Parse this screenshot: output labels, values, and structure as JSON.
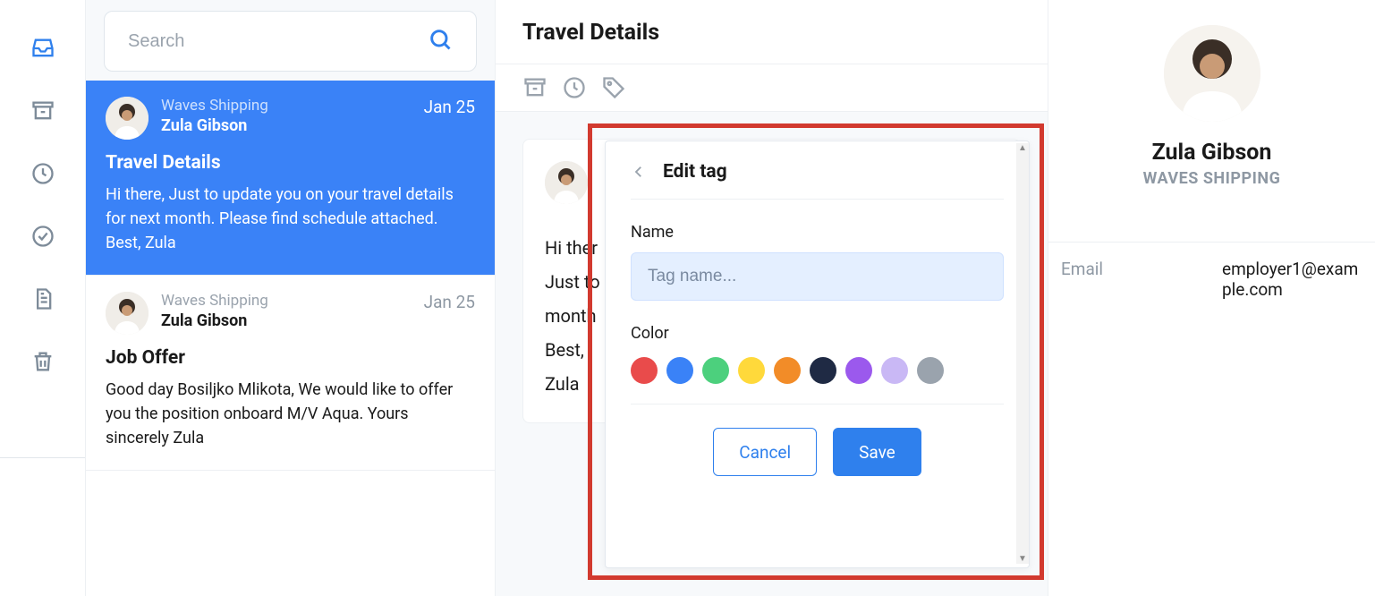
{
  "search": {
    "placeholder": "Search"
  },
  "messages": [
    {
      "company": "Waves Shipping",
      "sender": "Zula Gibson",
      "date": "Jan 25",
      "subject": "Travel Details",
      "preview": "Hi there, Just to update you on your travel details for next month. Please find schedule attached. Best, Zula"
    },
    {
      "company": "Waves Shipping",
      "sender": "Zula Gibson",
      "date": "Jan 25",
      "subject": "Job Offer",
      "preview": "Good day Bosiljko Mlikota, We would like to offer you the position onboard M/V Aqua. Yours sincerely Zula"
    }
  ],
  "detail": {
    "subject": "Travel Details",
    "body_lines": [
      "Hi ther",
      "Just to",
      "month",
      "Best,",
      "Zula"
    ]
  },
  "contact": {
    "name": "Zula Gibson",
    "company": "WAVES SHIPPING",
    "fields": [
      {
        "label": "Email",
        "value": "employer1@example.com"
      }
    ]
  },
  "popup": {
    "title": "Edit tag",
    "name_label": "Name",
    "name_placeholder": "Tag name...",
    "color_label": "Color",
    "colors": [
      "#e94b4b",
      "#3a82f7",
      "#4cd07d",
      "#ffd93b",
      "#f28c28",
      "#1f2a44",
      "#9b59ed",
      "#c9b8f5",
      "#9aa3ad"
    ],
    "cancel": "Cancel",
    "save": "Save"
  }
}
